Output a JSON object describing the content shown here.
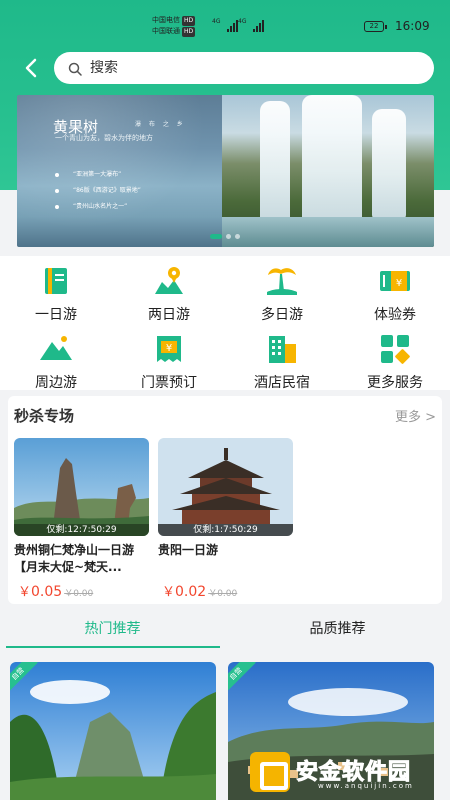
{
  "status_bar": {
    "carrier1": "中国电信",
    "carrier2": "中国联通",
    "hd": "HD",
    "net1": "4G",
    "net2": "4G",
    "battery": "22",
    "time": "16:09"
  },
  "header": {
    "back_icon": "chevron-left-icon",
    "search_placeholder": "搜索"
  },
  "banner": {
    "title": "黄果树",
    "subtitle_right": "瀑 布 之 乡",
    "slogan": "一个青山为友，碧水为伴的地方",
    "bullets": [
      "“亚洲第一大瀑布”",
      "“86版《西游记》取景地”",
      "“贵州山水名片之一”"
    ],
    "page_count": 3,
    "active_page": 1
  },
  "categories": [
    {
      "label": "一日游",
      "icon": "book-icon"
    },
    {
      "label": "两日游",
      "icon": "map-pin-icon"
    },
    {
      "label": "多日游",
      "icon": "palm-tree-icon"
    },
    {
      "label": "体验券",
      "icon": "coupon-icon"
    },
    {
      "label": "周边游",
      "icon": "mountain-icon"
    },
    {
      "label": "门票预订",
      "icon": "ticket-icon"
    },
    {
      "label": "酒店民宿",
      "icon": "hotel-icon"
    },
    {
      "label": "更多服务",
      "icon": "grid-more-icon"
    }
  ],
  "flash_sale": {
    "title": "秒杀专场",
    "more_label": "更多 >",
    "items": [
      {
        "remaining": "仅剩:12:7:50:29",
        "name": "贵州铜仁梵净山一日游【月末大促~梵天...",
        "currency": "￥",
        "price": "0.05",
        "old_price": "￥0.00"
      },
      {
        "remaining": "仅剩:1:7:50:29",
        "name": "贵阳一日游",
        "currency": "￥",
        "price": "0.02",
        "old_price": "￥0.00"
      }
    ]
  },
  "tabs": [
    {
      "label": "热门推荐",
      "active": true
    },
    {
      "label": "品质推荐",
      "active": false
    }
  ],
  "recommend": [
    {
      "tag": "自营"
    },
    {
      "tag": "自营"
    }
  ],
  "watermark": {
    "text": "安金软件园",
    "url": "www.anquijin.com"
  },
  "colors": {
    "brand": "#1fb98a",
    "price": "#f2462e"
  }
}
